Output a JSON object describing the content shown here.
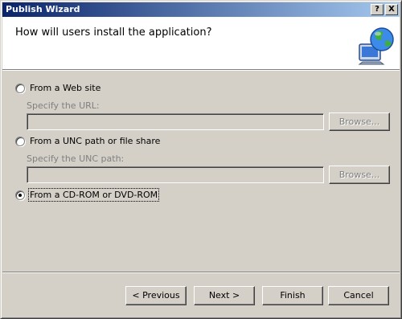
{
  "window": {
    "title": "Publish Wizard",
    "help_glyph": "?",
    "close_glyph": "X"
  },
  "header": {
    "title": "How will users install the application?",
    "icon": "globe-computer-icon"
  },
  "options": [
    {
      "label": "From a Web site",
      "checked": false,
      "field_label": "Specify the URL:",
      "field_value": "",
      "browse_label": "Browse..."
    },
    {
      "label": "From a UNC path or file share",
      "checked": false,
      "field_label": "Specify the UNC path:",
      "field_value": "",
      "browse_label": "Browse..."
    },
    {
      "label": "From a CD-ROM or DVD-ROM",
      "checked": true
    }
  ],
  "buttons": {
    "previous": "< Previous",
    "next": "Next >",
    "finish": "Finish",
    "cancel": "Cancel"
  },
  "colors": {
    "title_gradient_start": "#0a246a",
    "title_gradient_end": "#a6caf0",
    "face": "#d4d0c8"
  }
}
